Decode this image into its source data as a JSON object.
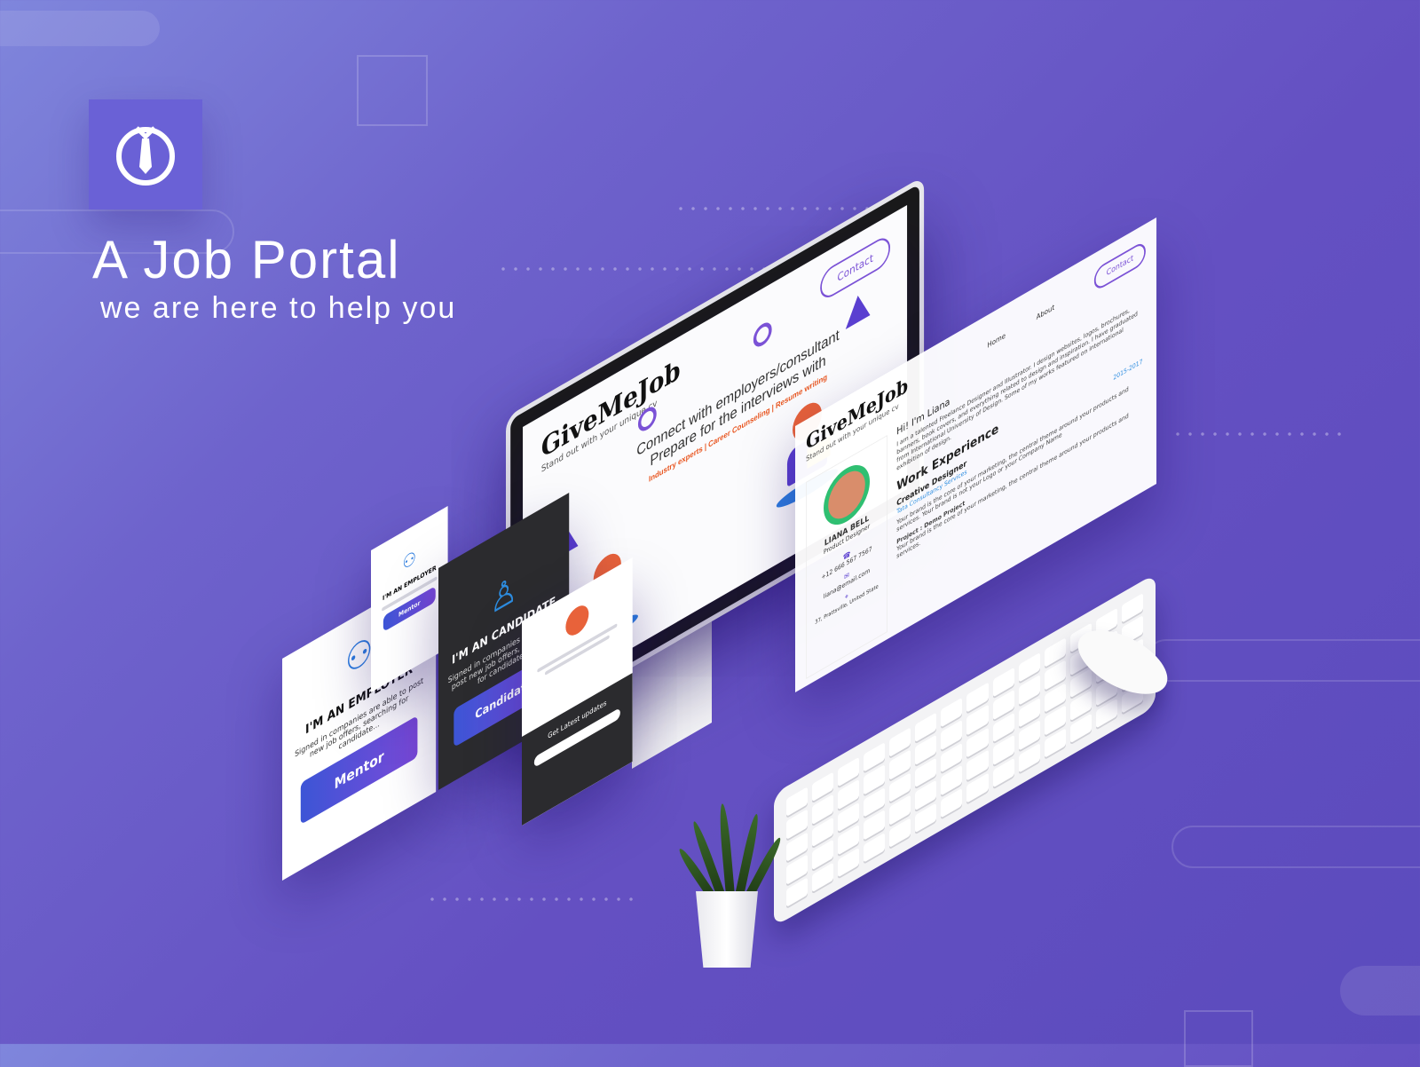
{
  "brand": {
    "title": "A Job Portal",
    "subtitle": "we are here to help you",
    "logo_icon": "tie-in-circle-icon"
  },
  "monitor_site": {
    "brand": "GiveMeJob",
    "tagline": "Stand out with your unique cv",
    "nav_contact": "Contact",
    "headline_1": "Connect with employers/consultant",
    "headline_2": "Prepare for the interviews with",
    "services": "Industry experts | Career Counseling | Resume writing"
  },
  "profile_panel": {
    "brand": "GiveMeJob",
    "tagline": "Stand out with your unique cv",
    "nav": [
      "Home",
      "About"
    ],
    "contact_label": "Contact",
    "greeting": "Hi! I'm Liana",
    "bio": "I am a talented Freelance Designer and Illustrator. I design websites, logos, brochures, banners, book covers, and everything related to design and inspiration. I have graduated from International University of Design. Some of my works featured on international exhibition of design.",
    "name": "LIANA BELL",
    "role": "Product Designer",
    "phone": "+12 666 567 7567",
    "email": "liana@email.com",
    "address": "37, Prattsville, United State",
    "section_title": "Work Experience",
    "job_title": "Creative Designer",
    "company": "Tata Consultancy Services",
    "job_years": "2015-2017",
    "job_desc": "Your brand is the core of your marketing, the central theme around your products and services. Your brand is not your Logo or your Company Name",
    "project_title": "Project : Demo Project",
    "project_desc": "Your brand is the core of your marketing, the central theme around your products and services."
  },
  "employer_card_large": {
    "title": "I'M AN EMPLOYER",
    "desc": "Signed in companies are able to post new job offers, searching for candidate...",
    "button": "Mentor"
  },
  "employer_card_small": {
    "title": "I'M AN EMPLOYER",
    "button": "Mentor"
  },
  "candidate_card": {
    "title": "I'M AN CANDIDATE",
    "desc": "Signed in companies are able to post new job offers, searching for candidate...",
    "button": "Candidate"
  },
  "mobile_card": {
    "newsletter": "Get Latest updates"
  }
}
